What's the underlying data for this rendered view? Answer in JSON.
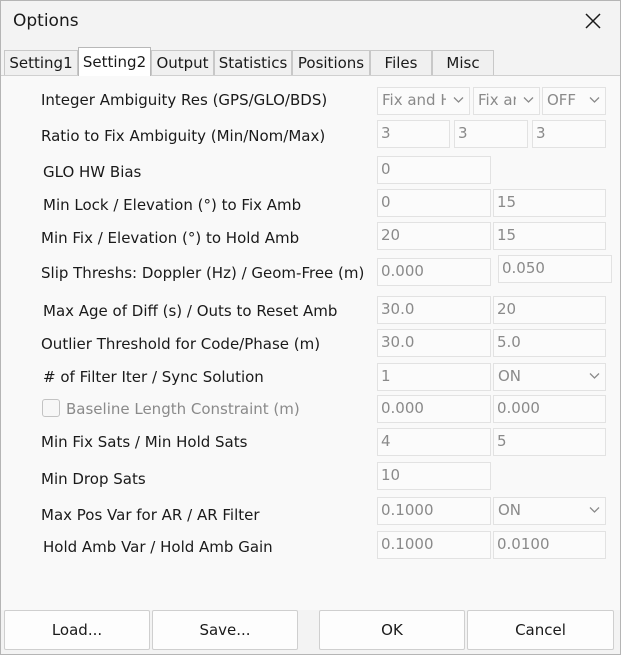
{
  "window": {
    "title": "Options"
  },
  "tabs": [
    "Setting1",
    "Setting2",
    "Output",
    "Statistics",
    "Positions",
    "Files",
    "Misc"
  ],
  "rows": {
    "integer_ambiguity": {
      "label": "Integer Ambiguity Res (GPS/GLO/BDS)",
      "values": [
        "Fix and Hold",
        "Fix and Hold",
        "OFF"
      ]
    },
    "ratio_fix": {
      "label": "Ratio to Fix Ambiguity (Min/Nom/Max)",
      "values": [
        "3",
        "3",
        "3"
      ]
    },
    "glo_hw_bias": {
      "label": "GLO HW Bias",
      "value": "0"
    },
    "min_lock_elev": {
      "label": "Min Lock / Elevation (°) to Fix Amb",
      "values": [
        "0",
        "15"
      ]
    },
    "min_fix_elev": {
      "label": "Min Fix / Elevation (°) to Hold Amb",
      "values": [
        "20",
        "15"
      ]
    },
    "slip_thresh": {
      "label": "Slip Threshs: Doppler (Hz) / Geom-Free (m)",
      "values": [
        "0.000",
        "0.050"
      ]
    },
    "max_age": {
      "label": "Max Age of Diff (s) / Outs to Reset Amb",
      "values": [
        "30.0",
        "20"
      ]
    },
    "outlier": {
      "label": "Outlier Threshold for Code/Phase (m)",
      "values": [
        "30.0",
        "5.0"
      ]
    },
    "filter_iter": {
      "label": "# of Filter Iter / Sync Solution",
      "values": [
        "1",
        "ON"
      ]
    },
    "baseline": {
      "label": "Baseline Length Constraint (m)",
      "values": [
        "0.000",
        "0.000"
      ],
      "checked": false
    },
    "min_fix_sats": {
      "label": "Min Fix Sats / Min Hold Sats",
      "values": [
        "4",
        "5"
      ]
    },
    "min_drop": {
      "label": "Min Drop Sats",
      "value": "10"
    },
    "max_pos_var": {
      "label": "Max Pos Var for AR / AR Filter",
      "values": [
        "0.1000",
        "ON"
      ]
    },
    "hold_amb_var": {
      "label": "Hold Amb Var / Hold Amb Gain",
      "values": [
        "0.1000",
        "0.0100"
      ]
    }
  },
  "buttons": {
    "load": "Load...",
    "save": "Save...",
    "ok": "OK",
    "cancel": "Cancel"
  },
  "icons": {
    "close": "close-icon",
    "dropdown": "chevron-down-icon",
    "checkbox": "checkbox-unchecked"
  }
}
